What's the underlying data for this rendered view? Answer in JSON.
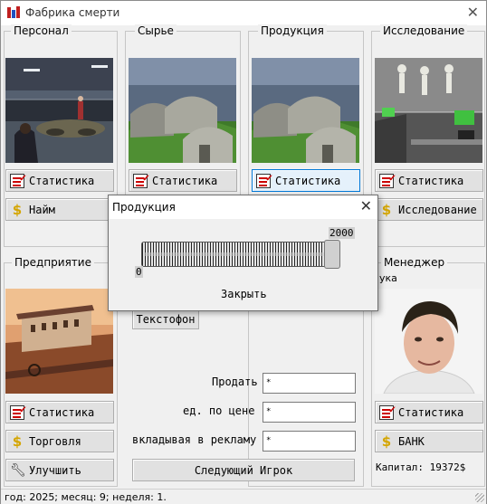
{
  "window": {
    "title": "Фабрика смерти"
  },
  "groups": {
    "personnel": {
      "label": "Персонал"
    },
    "raw": {
      "label": "Сырье"
    },
    "production": {
      "label": "Продукция"
    },
    "research": {
      "label": "Исследование"
    },
    "enterprise": {
      "label": "Предприятие"
    },
    "manager": {
      "label": "Менеджер"
    }
  },
  "buttons": {
    "stat": "Статистика",
    "hire": "Найм",
    "research": "Исследование",
    "trade": "Торговля",
    "improve": "Улучшить",
    "bank": "БАНК",
    "textophone": "Текстофон",
    "next_player": "Следующий Игрок"
  },
  "form": {
    "sell_label": "Продать",
    "price_label": "ед. по цене",
    "ads_label": "вкладывая в рекламу",
    "sell_value": "*",
    "price_value": "*",
    "ads_value": "*"
  },
  "manager_partial_text": "ука",
  "capital": "Капитал: 19372$",
  "status": "год: 2025; месяц: 9; неделя: 1.",
  "dialog": {
    "title": "Продукция",
    "max": "2000",
    "min": "0",
    "close": "Закрыть",
    "slider_fraction": 1.0
  },
  "icons": [
    "app-icon",
    "close-icon",
    "statistics-icon",
    "dollar-icon",
    "wrench-icon"
  ]
}
